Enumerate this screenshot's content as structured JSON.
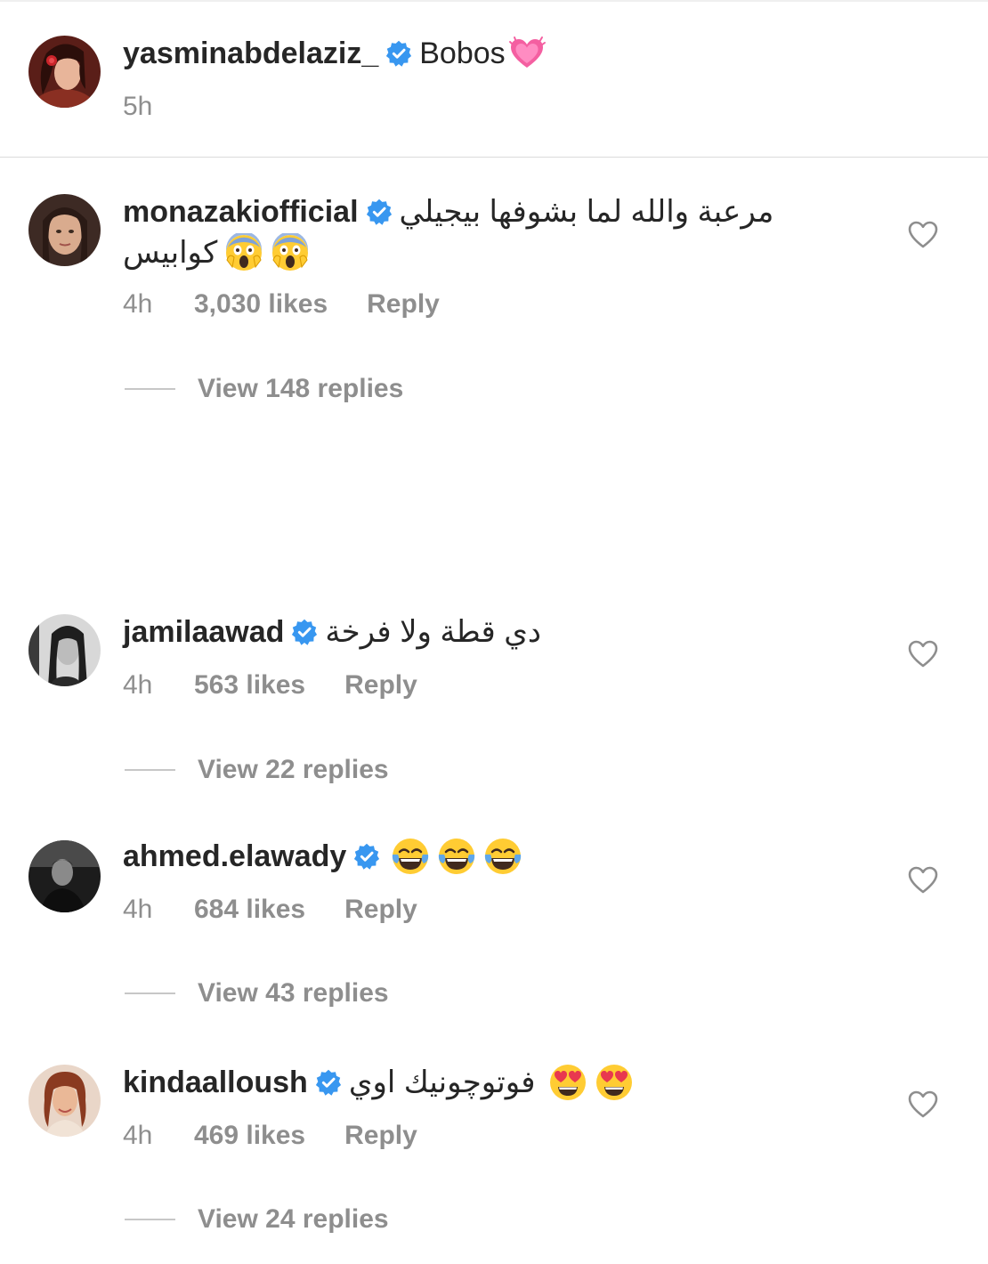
{
  "caption": {
    "username": "yasminabdelaziz_",
    "text": "Bobos",
    "emoji": "heart-emoji",
    "time": "5h"
  },
  "comments": [
    {
      "username": "monazakiofficial",
      "text_line1": "مرعبة والله لما بشوفها بيجيلي",
      "text_line2": "كوابيس",
      "emoji": "scream-emoji",
      "time": "4h",
      "likes": "3,030 likes",
      "reply_label": "Reply",
      "view_replies": "View 148 replies"
    },
    {
      "username": "jamilaawad",
      "text_line1": "دي قطة ولا فرخة",
      "time": "4h",
      "likes": "563 likes",
      "reply_label": "Reply",
      "view_replies": "View 22 replies"
    },
    {
      "username": "ahmed.elawady",
      "emoji": "tears-of-joy-emoji",
      "time": "4h",
      "likes": "684 likes",
      "reply_label": "Reply",
      "view_replies": "View 43 replies"
    },
    {
      "username": "kindaalloush",
      "text_line1": "فوتوچونيك اوي",
      "emoji": "heart-eyes-emoji",
      "time": "4h",
      "likes": "469 likes",
      "reply_label": "Reply",
      "view_replies": "View 24 replies"
    }
  ],
  "colors": {
    "text": "#262626",
    "secondary": "#8e8e8e",
    "verified": "#3897f0",
    "divider": "#dbdbdb"
  }
}
